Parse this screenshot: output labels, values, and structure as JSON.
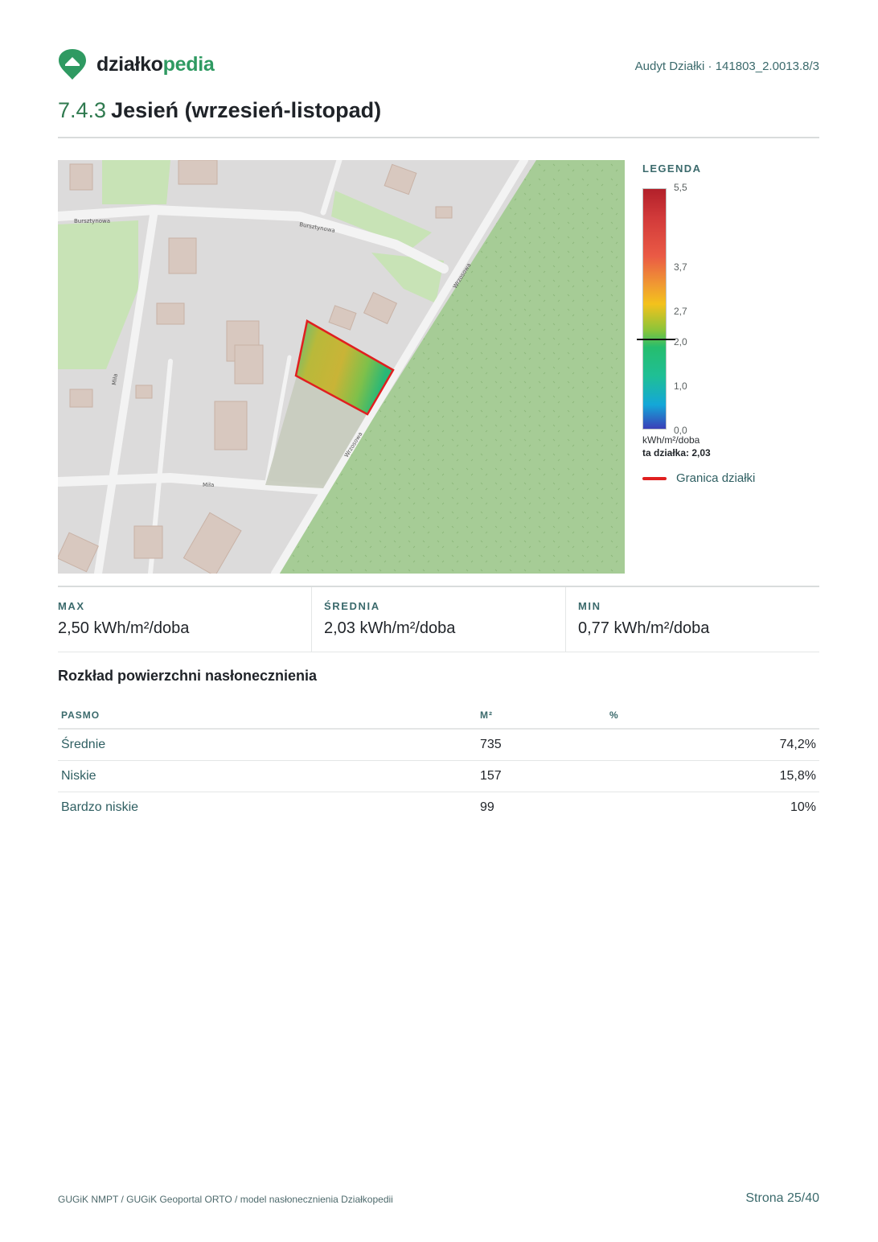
{
  "header": {
    "brand_part1": "działko",
    "brand_part2": "pedia",
    "doc_ref": "Audyt Działki · 141803_2.0013.8/3"
  },
  "section": {
    "number": "7.4.3",
    "title": "Jesień (wrzesień-listopad)"
  },
  "map": {
    "street_labels": [
      "Bursztynowa",
      "Bursztynowa",
      "Miła",
      "Miła",
      "Wrzosowa",
      "Wrzosowa"
    ]
  },
  "legend": {
    "title": "LEGENDA",
    "ticks": [
      "5,5",
      "3,7",
      "2,7",
      "2,0",
      "1,0",
      "0,0"
    ],
    "unit": "kWh/m²/doba",
    "this_plot": "ta działka: 2,03",
    "boundary_label": "Granica działki",
    "colors": {
      "high": "#b2202a",
      "mid": "#f3c21c",
      "low": "#3a3fb8",
      "boundary": "#e01f1f"
    }
  },
  "stats": [
    {
      "label": "MAX",
      "value": "2,50 kWh/m²/doba"
    },
    {
      "label": "ŚREDNIA",
      "value": "2,03 kWh/m²/doba"
    },
    {
      "label": "MIN",
      "value": "0,77 kWh/m²/doba"
    }
  ],
  "distribution": {
    "title": "Rozkład powierzchni nasłonecznienia",
    "headers": [
      "PASMO",
      "M²",
      "%"
    ],
    "rows": [
      {
        "band": "Średnie",
        "m2": "735",
        "pct": "74,2%"
      },
      {
        "band": "Niskie",
        "m2": "157",
        "pct": "15,8%"
      },
      {
        "band": "Bardzo niskie",
        "m2": "99",
        "pct": "10%"
      }
    ]
  },
  "footer": {
    "sources": "GUGiK NMPT / GUGiK Geoportal ORTO / model nasłonecznienia Działkopedii",
    "page": "Strona 25/40"
  }
}
